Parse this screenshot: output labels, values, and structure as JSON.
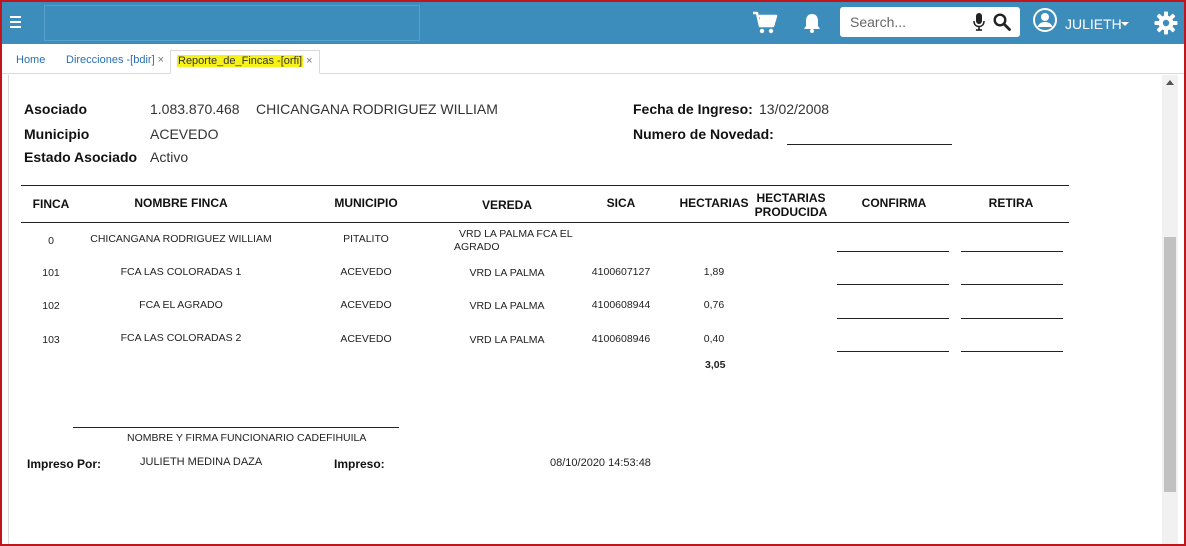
{
  "topbar": {
    "search_placeholder": "Search...",
    "user_name": "JULIETH"
  },
  "tabs": [
    {
      "label": "Home"
    },
    {
      "label": "Direcciones -[bdir]",
      "close": "×"
    },
    {
      "label": "Reporte_de_Fincas -[orfi]",
      "close": "×"
    }
  ],
  "report": {
    "asociado_label": "Asociado",
    "asociado_id": "1.083.870.468",
    "asociado_name": "CHICANGANA RODRIGUEZ WILLIAM",
    "municipio_label": "Municipio",
    "municipio_value": "ACEVEDO",
    "estado_label": "Estado Asociado",
    "estado_value": "Activo",
    "fecha_label": "Fecha de Ingreso:",
    "fecha_value": "13/02/2008",
    "novedad_label": "Numero de Novedad:"
  },
  "table": {
    "headers": {
      "finca": "FINCA",
      "nombre": "NOMBRE FINCA",
      "municipio": "MUNICIPIO",
      "vereda": "VEREDA",
      "sica": "SICA",
      "hectarias": "HECTARIAS",
      "producida_1": "HECTARIAS",
      "producida_2": "PRODUCIDA",
      "confirma": "CONFIRMA",
      "retira": "RETIRA"
    },
    "rows": [
      {
        "finca": "0",
        "nombre": "CHICANGANA RODRIGUEZ WILLIAM",
        "municipio": "PITALITO",
        "vereda_1": "VRD LA PALMA FCA EL",
        "vereda_2": "AGRADO",
        "sica": "",
        "hectarias": ""
      },
      {
        "finca": "101",
        "nombre": "FCA LAS COLORADAS 1",
        "municipio": "ACEVEDO",
        "vereda_1": "VRD LA PALMA",
        "vereda_2": "",
        "sica": "4100607127",
        "hectarias": "1,89"
      },
      {
        "finca": "102",
        "nombre": "FCA EL AGRADO",
        "municipio": "ACEVEDO",
        "vereda_1": "VRD LA PALMA",
        "vereda_2": "",
        "sica": "4100608944",
        "hectarias": "0,76"
      },
      {
        "finca": "103",
        "nombre": "FCA LAS COLORADAS 2",
        "municipio": "ACEVEDO",
        "vereda_1": "VRD LA PALMA",
        "vereda_2": "",
        "sica": "4100608946",
        "hectarias": "0,40"
      }
    ],
    "total_hectarias": "3,05"
  },
  "footer": {
    "firma_label": "NOMBRE Y FIRMA FUNCIONARIO CADEFIHUILA",
    "impreso_por_label": "Impreso Por:",
    "impreso_por_value": "JULIETH MEDINA DAZA",
    "impreso_label": "Impreso:",
    "impreso_value": "08/10/2020 14:53:48"
  }
}
